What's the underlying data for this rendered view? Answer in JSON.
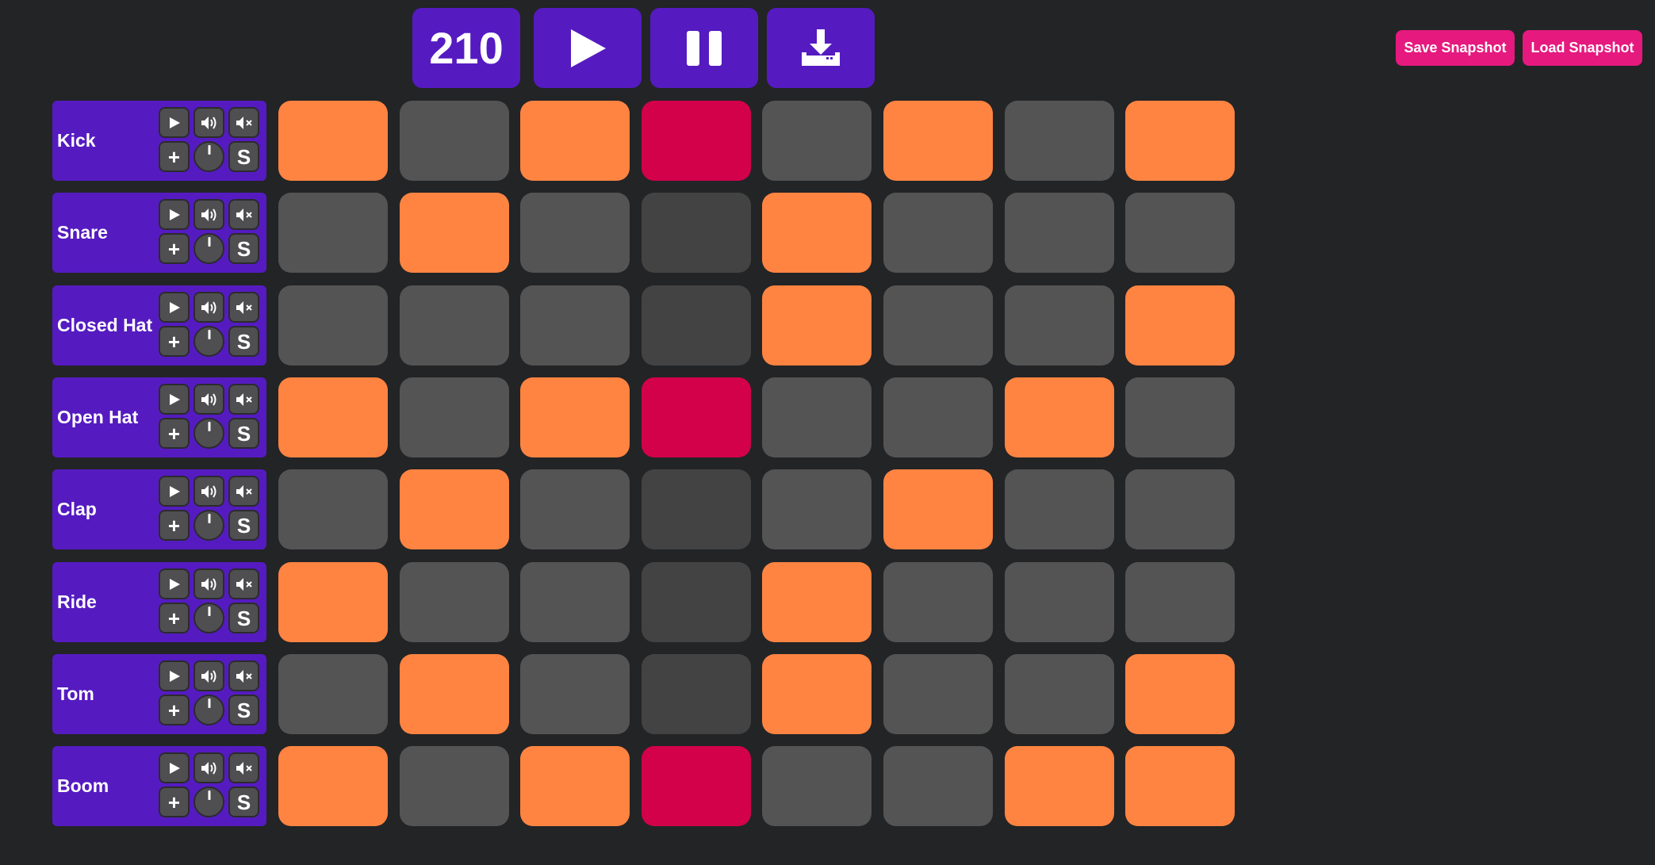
{
  "toolbar": {
    "bpm": "210",
    "play_icon": "play-icon",
    "pause_icon": "pause-icon",
    "download_icon": "download-icon"
  },
  "snapshot": {
    "save_label": "Save Snapshot",
    "load_label": "Load Snapshot"
  },
  "track_controls": {
    "play_icon": "play-icon",
    "volume_icon": "volume-icon",
    "mute_icon": "mute-icon",
    "add_glyph": "+",
    "solo_glyph": "S"
  },
  "colors": {
    "background": "#232426",
    "accent_purple": "#551bc1",
    "snapshot_pink": "#e5197e",
    "step_on": "#ff8442",
    "step_highlight": "#d3004a",
    "step_off": "#545454",
    "step_off_dark": "#434343"
  },
  "tracks": [
    {
      "name": "Kick",
      "steps": [
        "on",
        "off",
        "on",
        "hl",
        "off",
        "on",
        "off",
        "on"
      ]
    },
    {
      "name": "Snare",
      "steps": [
        "off",
        "on",
        "off",
        "off",
        "on",
        "off",
        "off",
        "off"
      ]
    },
    {
      "name": "Closed Hat",
      "steps": [
        "off",
        "off",
        "off",
        "off",
        "on",
        "off",
        "off",
        "on"
      ]
    },
    {
      "name": "Open Hat",
      "steps": [
        "on",
        "off",
        "on",
        "hl",
        "off",
        "off",
        "on",
        "off"
      ]
    },
    {
      "name": "Clap",
      "steps": [
        "off",
        "on",
        "off",
        "off",
        "off",
        "on",
        "off",
        "off"
      ]
    },
    {
      "name": "Ride",
      "steps": [
        "on",
        "off",
        "off",
        "off",
        "on",
        "off",
        "off",
        "off"
      ]
    },
    {
      "name": "Tom",
      "steps": [
        "off",
        "on",
        "off",
        "off",
        "on",
        "off",
        "off",
        "on"
      ]
    },
    {
      "name": "Boom",
      "steps": [
        "on",
        "off",
        "on",
        "hl",
        "off",
        "off",
        "on",
        "on"
      ]
    }
  ]
}
